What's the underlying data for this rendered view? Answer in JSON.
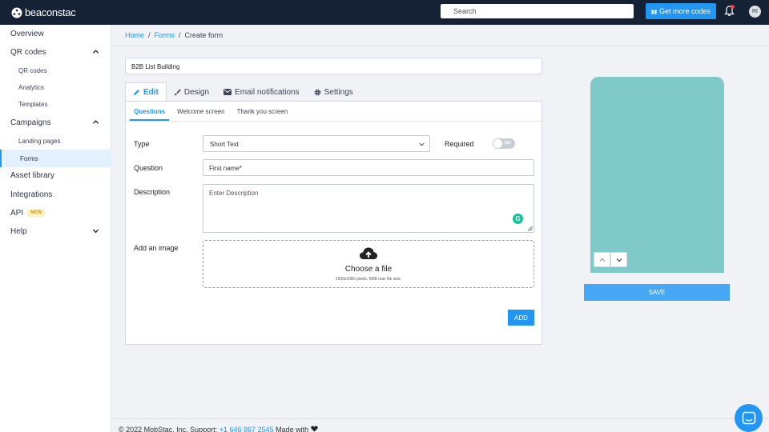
{
  "app": {
    "logo_text": "beaconstac",
    "search_placeholder": "Search",
    "get_more_label": "Get more codes",
    "avatar_initials": "RI"
  },
  "sidebar": {
    "items": [
      {
        "label": "Overview"
      },
      {
        "label": "QR codes",
        "expanded": true
      },
      {
        "label": "QR codes"
      },
      {
        "label": "Analytics"
      },
      {
        "label": "Templates"
      },
      {
        "label": "Campaigns",
        "expanded": true
      },
      {
        "label": "Landing pages"
      },
      {
        "label": "Forms",
        "active": true
      },
      {
        "label": "Asset library"
      },
      {
        "label": "Integrations"
      },
      {
        "label": "API",
        "badge": "NEW"
      },
      {
        "label": "Help",
        "expanded": false
      }
    ]
  },
  "breadcrumb": {
    "home": "Home",
    "forms": "Forms",
    "current": "Create form",
    "separator": "/"
  },
  "form": {
    "name_value": "B2B List Building",
    "tabs": [
      {
        "label": "Edit",
        "icon": "pencil-icon",
        "active": true
      },
      {
        "label": "Design",
        "icon": "brush-icon"
      },
      {
        "label": "Email notifications",
        "icon": "envelope-icon"
      },
      {
        "label": "Settings",
        "icon": "gear-icon"
      }
    ],
    "subtabs": [
      {
        "label": "Questions",
        "active": true
      },
      {
        "label": "Welcome screen"
      },
      {
        "label": "Thank you screen"
      }
    ],
    "type_label": "Type",
    "type_value": "Short Text",
    "required_label": "Required",
    "required_toggle_text": "NO",
    "question_label": "Question",
    "question_value": "First name*",
    "description_label": "Description",
    "description_placeholder": "Enter Description",
    "grammarly_glyph": "G",
    "image_label": "Add an image",
    "dropzone_title": "Choose a file",
    "dropzone_hint": "1920x1080 pixels. 5MB max file size.",
    "add_label": "ADD"
  },
  "preview": {
    "save_label": "SAVE",
    "background_color": "#80c9c9"
  },
  "footer": {
    "copyright": "© 2022 MobStac, Inc. Support:",
    "phone": "+1 646 867 2545",
    "made_with": "Made with"
  },
  "colors": {
    "accent": "#2296f3",
    "topbar": "#152135"
  }
}
